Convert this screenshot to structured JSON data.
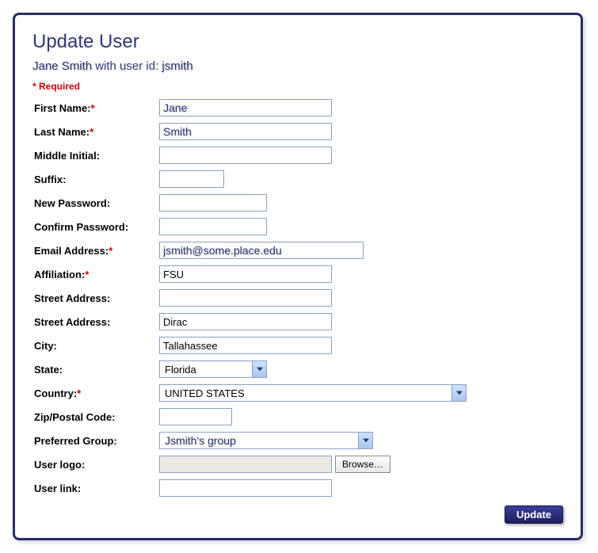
{
  "page_title": "Update User",
  "subtitle": {
    "user_name": "Jane Smith",
    "mid_text": " with user id: ",
    "user_id": "jsmith"
  },
  "required_note": "* Required",
  "labels": {
    "first_name": "First Name:",
    "last_name": "Last Name:",
    "middle_initial": "Middle Initial:",
    "suffix": "Suffix:",
    "new_password": "New Password:",
    "confirm_password": "Confirm Password:",
    "email": "Email Address:",
    "affiliation": "Affiliation:",
    "street1": "Street Address:",
    "street2": "Street Address:",
    "city": "City:",
    "state": "State:",
    "country": "Country:",
    "zip": "Zip/Postal Code:",
    "preferred_group": "Preferred Group:",
    "user_logo": "User logo:",
    "user_link": "User link:"
  },
  "values": {
    "first_name": "Jane",
    "last_name": "Smith",
    "middle_initial": "",
    "suffix": "",
    "new_password": "",
    "confirm_password": "",
    "email": "jsmith@some.place.edu",
    "affiliation": "FSU",
    "street1": "",
    "street2": "Dirac",
    "city": "Tallahassee",
    "state": "Florida",
    "country": "UNITED STATES",
    "zip": "",
    "preferred_group": "Jsmith's group",
    "user_logo": "",
    "user_link": ""
  },
  "buttons": {
    "browse": "Browse…",
    "update": "Update"
  },
  "required_star": "*"
}
